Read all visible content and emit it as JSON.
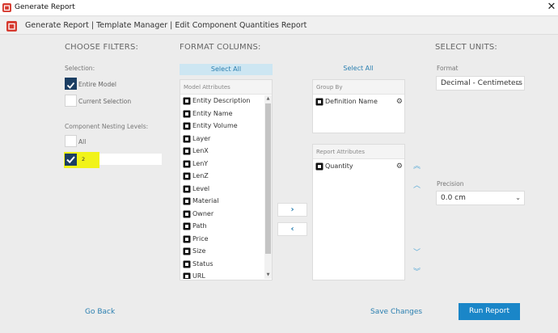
{
  "window": {
    "title": "Generate Report",
    "close_glyph": "✕"
  },
  "nav": {
    "breadcrumb": "Generate Report  |  Template Manager  |  Edit Component Quantities Report"
  },
  "filters": {
    "heading": "CHOOSE FILTERS:",
    "selection_label": "Selection:",
    "entire_model": {
      "label": "Entire Model",
      "checked": true
    },
    "current_selection": {
      "label": "Current Selection",
      "checked": false
    },
    "nesting_label": "Component Nesting Levels:",
    "all": {
      "label": "All",
      "checked": false
    },
    "nesting_level": {
      "checked": true,
      "value": "2"
    }
  },
  "format": {
    "heading": "FORMAT COLUMNS:",
    "select_all_left": "Select All",
    "select_all_right": "Select All",
    "model_attributes_label": "Model Attributes",
    "model_attributes": [
      "Entity Description",
      "Entity Name",
      "Entity Volume",
      "Layer",
      "LenX",
      "LenY",
      "LenZ",
      "Level",
      "Material",
      "Owner",
      "Path",
      "Price",
      "Size",
      "Status",
      "URL"
    ],
    "move_right": "›",
    "move_left": "‹",
    "group_by_label": "Group By",
    "group_by": [
      "Definition Name"
    ],
    "report_attributes_label": "Report Attributes",
    "report_attributes": [
      "Quantity"
    ],
    "order_top": "︽",
    "order_up": "︿",
    "order_down": "﹀",
    "order_bottom": "︾"
  },
  "units": {
    "heading": "SELECT UNITS:",
    "format_label": "Format",
    "format_value": "Decimal - Centimeters",
    "precision_label": "Precision",
    "precision_value": "0.0 cm"
  },
  "footer": {
    "go_back": "Go Back",
    "save_changes": "Save Changes",
    "run_report": "Run Report"
  },
  "icons": {
    "app": "sketchup-logo-icon",
    "attribute": "component-icon",
    "settings": "gear-icon"
  },
  "colors": {
    "accent": "#1a86c8",
    "link": "#2a7fb0",
    "checkbox": "#1b3e63",
    "highlight": "#f1f31a",
    "select_all_bg": "#cde6f2"
  }
}
